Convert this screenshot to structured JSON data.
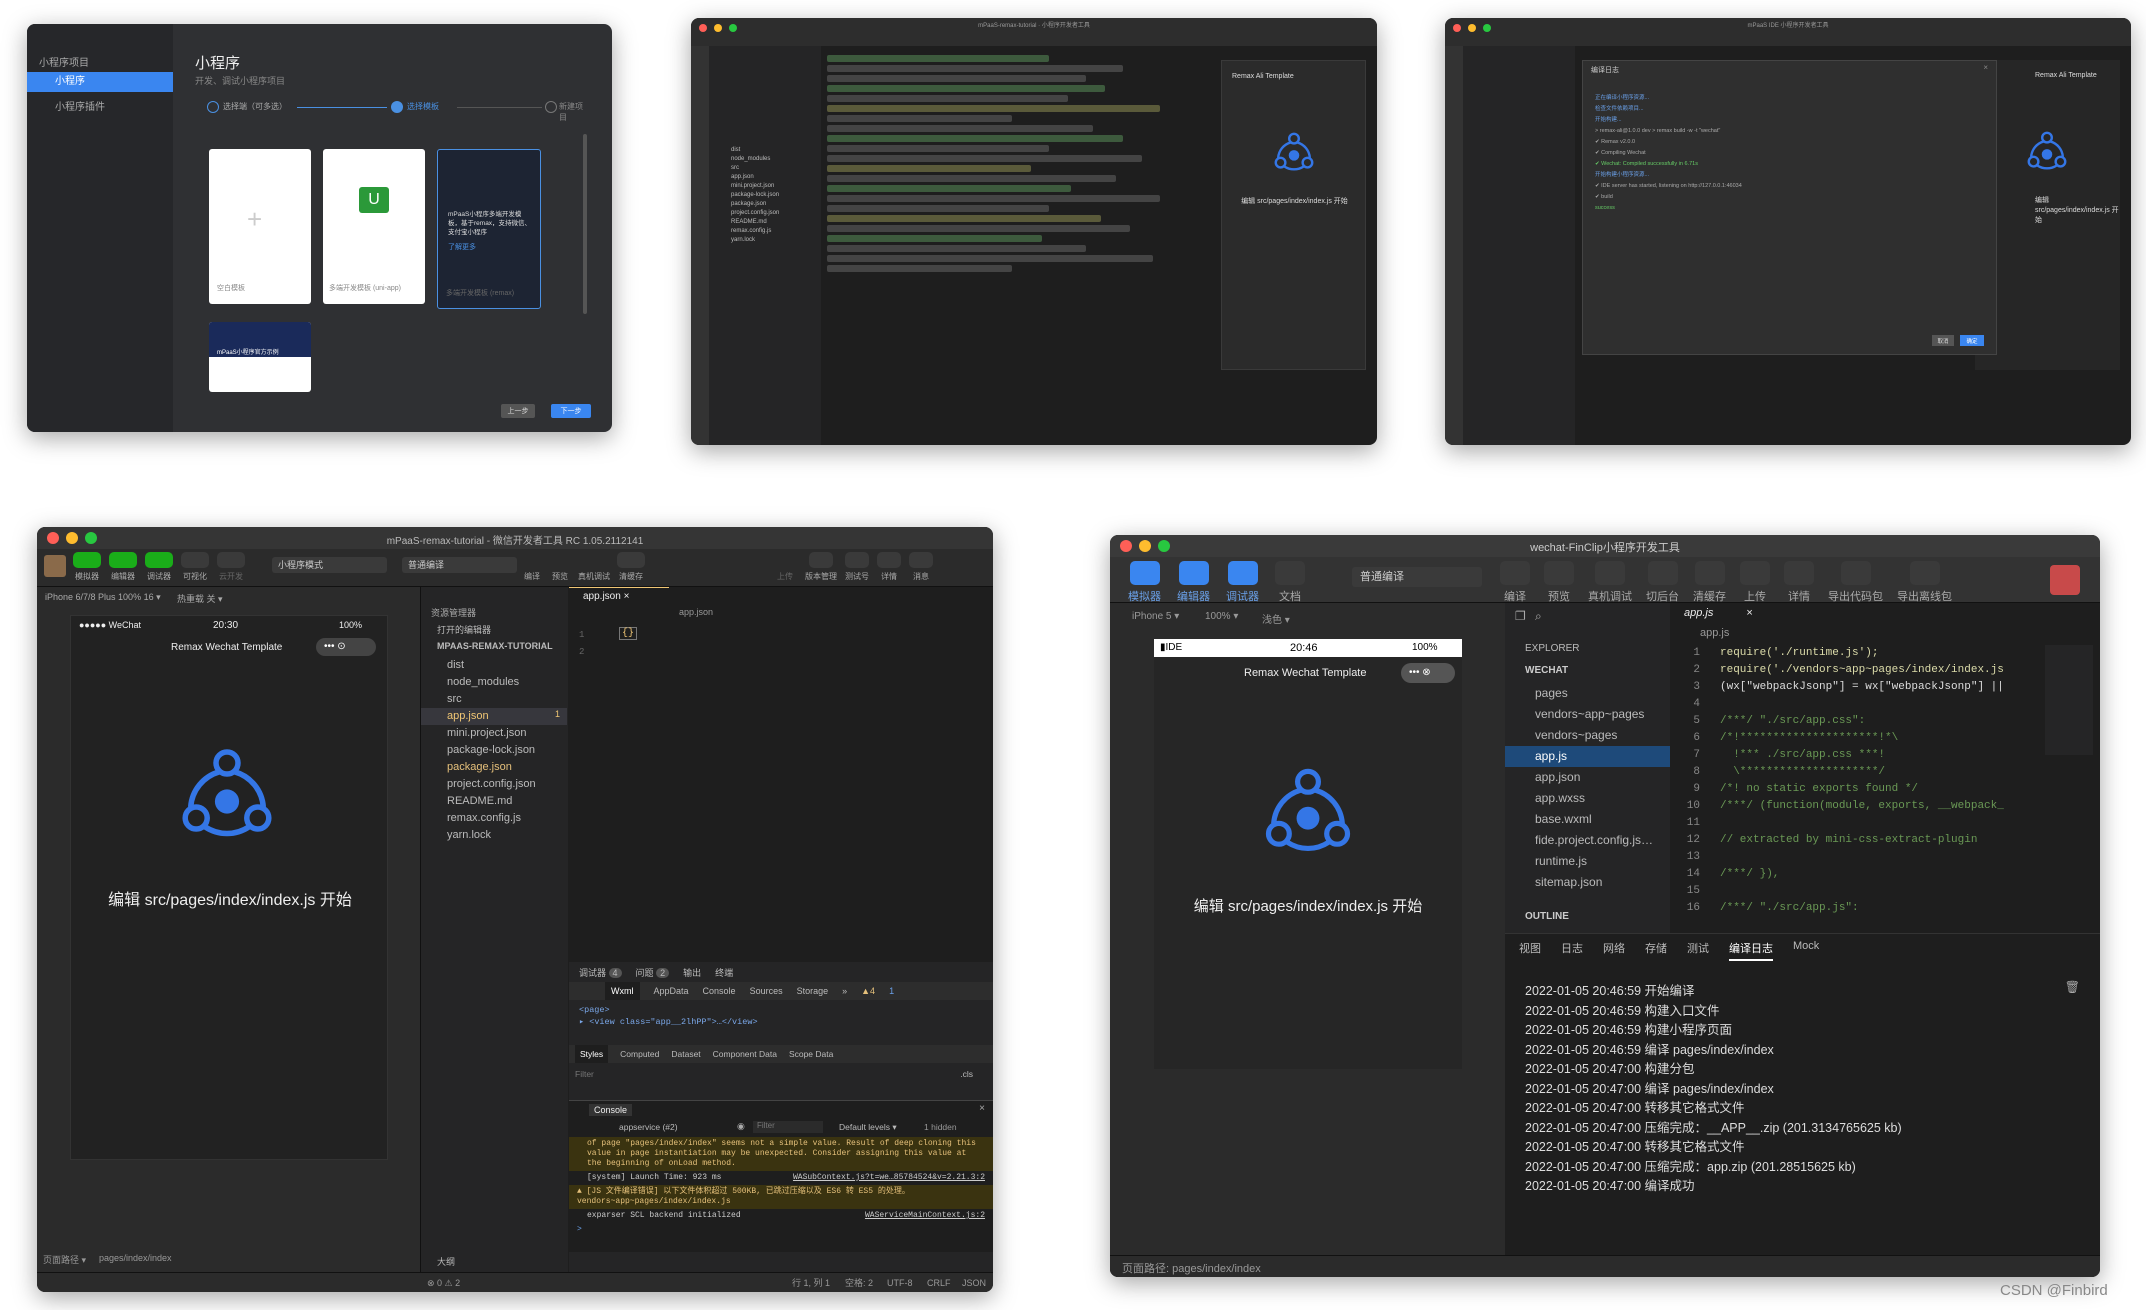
{
  "w1": {
    "sidebar": [
      "小程序项目",
      "小程序",
      "小程序插件"
    ],
    "title": "小程序",
    "subtitle": "开发、调试小程序项目",
    "steps": [
      "选择端（可多选）",
      "选择模板",
      "新建项目"
    ],
    "templates": [
      {
        "label": "空白模板"
      },
      {
        "label": "多端开发模板 (uni-app)"
      },
      {
        "label": "多端开发模板 (remax)",
        "desc": "mPaaS小程序多端开发模板，基于remax，支持微信、支付宝小程序",
        "link": "了解更多"
      }
    ],
    "thumb_caption": "mPaaS小程序官方示例",
    "btn_prev": "上一步",
    "btn_next": "下一步"
  },
  "w2": {
    "title": "mPaaS-remax-tutorial · 小程序开发者工具",
    "preview_title": "Remax Ali Template",
    "preview_hint": "编辑 src/pages/index/index.js 开始",
    "tree": [
      "dist",
      "node_modules",
      "src",
      "app.json",
      "mini.project.json",
      "package-lock.json",
      "package.json",
      "project.config.json",
      "README.md",
      "remax.config.js",
      "yarn.lock"
    ]
  },
  "w3": {
    "title": "mPaaS IDE 小程序开发者工具",
    "dialog_title": "编译日志",
    "preview_title": "Remax Ali Template",
    "preview_hint": "编辑 src/pages/index/index.js 开始",
    "log": [
      "正在编译小程序资源...",
      "检查文件依赖项目...",
      "开始构建...",
      "> remax-ali@1.0.0 dev > remax build -w -t \"wechat\"",
      "✔ Remax v2.0.0",
      "✔ Compiling Wechat",
      "✔ Wechat: Compiled successfully in 6.71s",
      "开始构建小程序资源...",
      "✔ IDE server has started, listening on http://127.0.0.1:46034",
      "✔ build",
      "success"
    ],
    "btn_cancel": "取消",
    "btn_ok": "确定"
  },
  "w4": {
    "title": "mPaaS-remax-tutorial - 微信开发者工具 RC 1.05.2112141",
    "toolbar": [
      "模拟器",
      "编辑器",
      "调试器",
      "可视化",
      "云开发"
    ],
    "mode": "小程序模式",
    "compile": "普通编译",
    "toolbar_right": [
      "编译",
      "预览",
      "真机调试",
      "清缓存",
      "上传",
      "版本管理",
      "测试号",
      "详情",
      "消息"
    ],
    "device": "iPhone 6/7/8 Plus 100% 16 ▾",
    "hot_reload": "热重载 关 ▾",
    "phone_carrier": "●●●●● WeChat",
    "phone_time": "20:30",
    "phone_battery": "100%",
    "phone_nav_title": "Remax Wechat Template",
    "phone_hint": "编辑 src/pages/index/index.js 开始",
    "explorer_title": "资源管理器",
    "open_editors": "打开的编辑器",
    "project": "MPAAS-REMAX-TUTORIAL",
    "files": [
      "dist",
      "node_modules",
      "src",
      "app.json",
      "mini.project.json",
      "package-lock.json",
      "package.json",
      "project.config.json",
      "README.md",
      "remax.config.js",
      "yarn.lock"
    ],
    "file_badge": "1",
    "outline": "大纲",
    "editor_tab": "app.json",
    "breadcrumb": "app.json",
    "code_lines": [
      "1",
      "2"
    ],
    "code_text": "{}",
    "panel_tabs": [
      "调试器",
      "问题",
      "输出",
      "终端"
    ],
    "panel_badges": [
      "4",
      "2"
    ],
    "devtools_tabs": [
      "Wxml",
      "AppData",
      "Console",
      "Sources",
      "Storage"
    ],
    "devtools_more": "»",
    "warn_count": "▲4",
    "err_count": "1",
    "wxml_lines": [
      "<page>",
      "▸ <view class=\"app__2lhPP\">…</view>"
    ],
    "styles_tabs": [
      "Styles",
      "Computed",
      "Dataset",
      "Component Data",
      "Scope Data"
    ],
    "filter_placeholder": "Filter",
    "cls": ".cls",
    "console_title": "Console",
    "console_context": "appservice (#2)",
    "default_levels": "Default levels ▾",
    "hidden": "1 hidden",
    "console_lines": [
      {
        "text": "of page \"pages/index/index\" seems not a simple value. Result of deep cloning this value in page instantiation may be unexpected. Consider assigning this value at the beginning of onLoad method.",
        "type": "warn"
      },
      {
        "text": "[system] Launch Time: 923 ms",
        "type": "info",
        "link": "WASubContext.js?t=we…85784524&v=2.21.3:2"
      },
      {
        "text": "▲ [JS 文件编译错误] 以下文件体积超过 500KB, 已跳过压缩以及 ES6 转 ES5 的处理。vendors~app~pages/index/index.js",
        "type": "warn"
      },
      {
        "text": "exparser SCL backend initialized",
        "type": "info",
        "link": "WAServiceMainContext.js:2"
      }
    ],
    "console_prompt": ">",
    "status_left": "页面路径 ▾",
    "status_path": "pages/index/index",
    "status_errors": "⊗ 0 ⚠ 2",
    "status_right": [
      "行 1, 列 1",
      "空格: 2",
      "UTF-8",
      "CRLF",
      "JSON"
    ]
  },
  "w5": {
    "title": "wechat-FinClip小程序开发工具",
    "toolbar": [
      "模拟器",
      "编辑器",
      "调试器",
      "文档"
    ],
    "compile": "普通编译",
    "toolbar_right": [
      "编译",
      "预览",
      "真机调试",
      "切后台",
      "清缓存",
      "上传",
      "详情",
      "导出代码包",
      "导出离线包"
    ],
    "device": "iPhone 5 ▾",
    "zoom": "100% ▾",
    "theme": "浅色 ▾",
    "phone_carrier": "▮IDE",
    "phone_time": "20:46",
    "phone_battery": "100%",
    "phone_nav_title": "Remax Wechat Template",
    "phone_hint": "编辑 src/pages/index/index.js 开始",
    "explorer_title": "EXPLORER",
    "project": "WECHAT",
    "files": [
      "pages",
      "vendors~app~pages",
      "vendors~pages",
      "app.js",
      "app.json",
      "app.wxss",
      "base.wxml",
      "fide.project.config.js…",
      "runtime.js",
      "sitemap.json"
    ],
    "outline": "OUTLINE",
    "editor_tab": "app.js",
    "breadcrumb": "app.js",
    "code": [
      "require('./runtime.js');",
      "require('./vendors~app~pages/index/index.js",
      "(wx[\"webpackJsonp\"] = wx[\"webpackJsonp\"] ||",
      "",
      "/***/ \"./src/app.css\":",
      "/*!*********************!*\\",
      "  !*** ./src/app.css ***!",
      "  \\*********************/",
      "/*! no static exports found */",
      "/***/ (function(module, exports, __webpack_",
      "",
      "// extracted by mini-css-extract-plugin",
      "",
      "/***/ }),",
      "",
      "/***/ \"./src/app.js\":"
    ],
    "panel_tabs": [
      "视图",
      "日志",
      "网络",
      "存储",
      "测试",
      "编译日志",
      "Mock"
    ],
    "log": [
      "2022-01-05 20:46:59 开始编译",
      "2022-01-05 20:46:59 构建入口文件",
      "2022-01-05 20:46:59 构建小程序页面",
      "2022-01-05 20:46:59 编译 pages/index/index",
      "2022-01-05 20:47:00 构建分包",
      "2022-01-05 20:47:00 编译 pages/index/index",
      "2022-01-05 20:47:00 转移其它格式文件",
      "2022-01-05 20:47:00 压缩完成：__APP__.zip (201.3134765625 kb)",
      "2022-01-05 20:47:00 转移其它格式文件",
      "2022-01-05 20:47:00 压缩完成：app.zip (201.28515625 kb)",
      "2022-01-05 20:47:00 编译成功"
    ],
    "status_path": "页面路径: pages/index/index"
  },
  "watermark": "CSDN @Finbird",
  "colors": {
    "accent": "#4a90e2",
    "logo_blue": "#3476e6",
    "dark_bg": "#1e1e1e",
    "panel_bg": "#252526"
  }
}
